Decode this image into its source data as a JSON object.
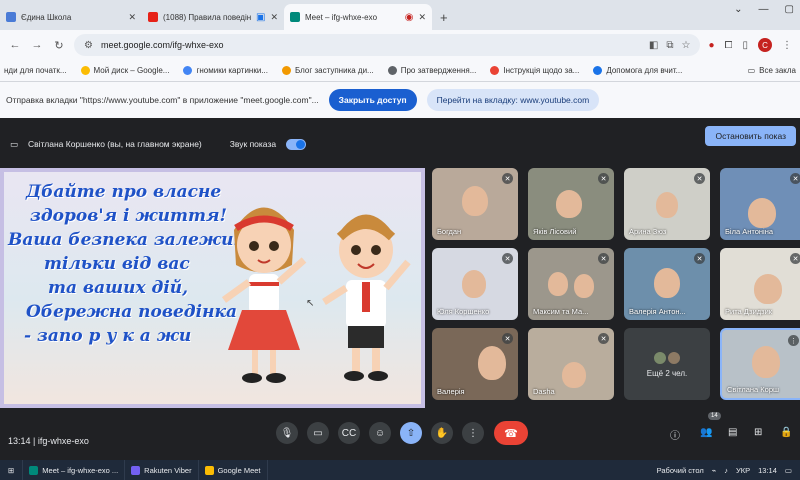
{
  "browser": {
    "tabs": [
      {
        "title": "Єдина Школа",
        "favicon_color": "#4a7bd6"
      },
      {
        "title": "(1088) Правила поведінки",
        "favicon_color": "#e62117"
      },
      {
        "title": "Meet – ifg-whxe-exo",
        "favicon_color": "#00897b",
        "active": true
      }
    ],
    "new_tab": "+",
    "url": "meet.google.com/ifg-whxe-exo",
    "avatar_letter": "С",
    "bookmarks": [
      {
        "label": "нди для початк...",
        "color": "#4a7bd6"
      },
      {
        "label": "Мой диск – Google...",
        "color": "#fbbc04"
      },
      {
        "label": "гномики картинки...",
        "color": "#4285f4"
      },
      {
        "label": "Блог заступника ди...",
        "color": "#f29900"
      },
      {
        "label": "Про затвердження...",
        "color": "#5f6368"
      },
      {
        "label": "Інструкція щодо за...",
        "color": "#ea4335"
      },
      {
        "label": "Допомога для вчит...",
        "color": "#1a73e8"
      }
    ],
    "bookmarks_all": "Все закла",
    "infobar": {
      "text": "Отправка вкладки \"https://www.youtube.com\" в приложение \"meet.google.com\"...",
      "primary": "Закрыть доступ",
      "secondary": "Перейти на вкладку: www.youtube.com"
    }
  },
  "meet": {
    "presenter": "Світлана Коршенко (вы, на главном экране)",
    "sound_label": "Звук показа",
    "stop_button": "Остановить показ",
    "slide_lines": [
      "Дбайте про власне",
      "здоров'я і життя!",
      "Ваша безпека залежить",
      "тільки від вас",
      "та ваших дій,",
      "Обережна поведінка",
      "- запо р у к а  жи"
    ],
    "participants": [
      {
        "name": "Богдан"
      },
      {
        "name": "Яків Лісовий"
      },
      {
        "name": "Арина Зюз"
      },
      {
        "name": "Біла Антоніна"
      },
      {
        "name": "Юля Коршенко"
      },
      {
        "name": "Максим та Ма..."
      },
      {
        "name": "Валерія Антон..."
      },
      {
        "name": "Рита Дзидзик"
      },
      {
        "name": "Валерія"
      },
      {
        "name": "Dasha"
      },
      {
        "name": "Світлана Корш"
      }
    ],
    "more_label": "Ещё 2 чел.",
    "meeting_time": "13:14",
    "meeting_code": "ifg-whxe-exo",
    "people_count": "14"
  },
  "taskbar": {
    "items": [
      {
        "label": "Meet – ifg-whxe-exo ...",
        "color": "#00897b"
      },
      {
        "label": "Rakuten Viber",
        "color": "#7360f2"
      },
      {
        "label": "Google Meet",
        "color": "#fbbc04"
      }
    ],
    "desktop": "Рабочий стол",
    "lang": "УКР",
    "clock": "13:14"
  }
}
